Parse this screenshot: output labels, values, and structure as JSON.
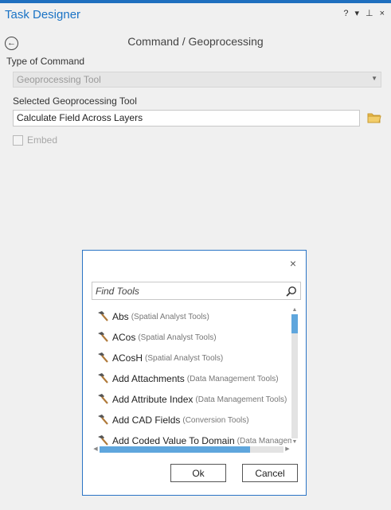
{
  "pane": {
    "title": "Task Designer",
    "help_glyph": "?",
    "menu_glyph": "▾",
    "pin_glyph": "⊥",
    "close_glyph": "×"
  },
  "page": {
    "heading": "Command / Geoprocessing",
    "back_icon": "arrow-left-circle-icon",
    "type_label": "Type of Command",
    "type_value": "Geoprocessing Tool",
    "tool_label": "Selected Geoprocessing Tool",
    "tool_value": "Calculate Field Across Layers",
    "embed_label": "Embed",
    "embed_checked": false
  },
  "dialog": {
    "close_glyph": "×",
    "search_placeholder": "Find Tools",
    "tools": [
      {
        "name": "Abs",
        "toolbox": "(Spatial Analyst Tools)"
      },
      {
        "name": "ACos",
        "toolbox": "(Spatial Analyst Tools)"
      },
      {
        "name": "ACosH",
        "toolbox": "(Spatial Analyst Tools)"
      },
      {
        "name": "Add Attachments",
        "toolbox": "(Data Management Tools)"
      },
      {
        "name": "Add Attribute Index",
        "toolbox": "(Data Management Tools)"
      },
      {
        "name": "Add CAD Fields",
        "toolbox": "(Conversion Tools)"
      },
      {
        "name": "Add Coded Value To Domain",
        "toolbox": "(Data Managem"
      }
    ],
    "ok_label": "Ok",
    "cancel_label": "Cancel"
  },
  "colors": {
    "accent": "#1a73c5",
    "dialog_border": "#2a74c5",
    "scroll_thumb": "#5fa6dd",
    "folder": "#e8b84a"
  }
}
